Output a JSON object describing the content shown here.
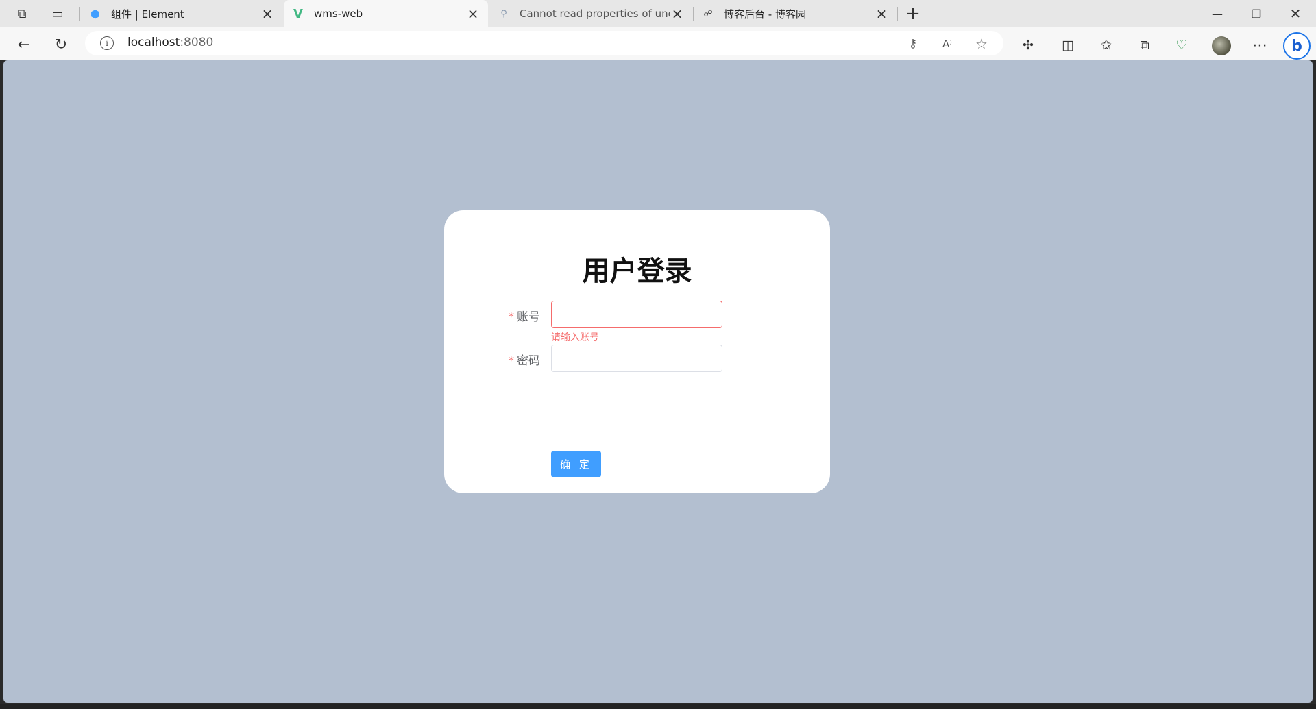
{
  "browser": {
    "tabs": [
      {
        "label": "组件 | Element",
        "favicon": "element-ui-icon",
        "active": false
      },
      {
        "label": "wms-web",
        "favicon": "vue-icon",
        "active": true
      },
      {
        "label": "Cannot read properties of undefi",
        "favicon": "search-icon",
        "active": false
      },
      {
        "label": "博客后台 - 博客园",
        "favicon": "cnblogs-icon",
        "active": false
      }
    ],
    "url_host": "localhost",
    "url_port": ":8080"
  },
  "login": {
    "title": "用户登录",
    "account_label": "账号",
    "password_label": "密码",
    "required_mark": "*",
    "account_value": "",
    "password_value": "",
    "account_error": "请输入账号",
    "submit_label": "确 定"
  },
  "colors": {
    "page_bg": "#b3bfd0",
    "primary": "#409eff",
    "error": "#f56c6c"
  }
}
